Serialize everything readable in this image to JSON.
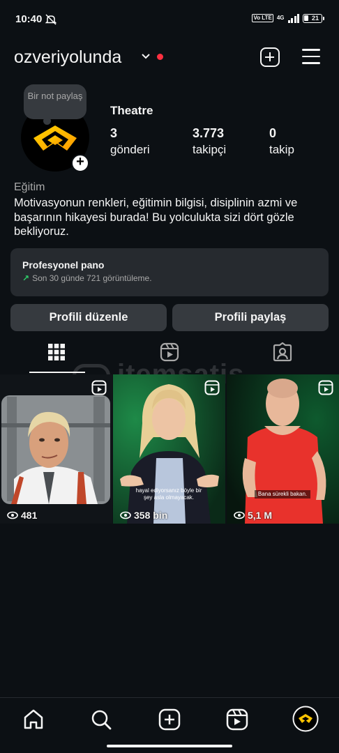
{
  "status_bar": {
    "time": "10:40",
    "volte": "Vo LTE",
    "network": "4G",
    "battery": "21"
  },
  "header": {
    "username": "ozveriyolunda"
  },
  "profile": {
    "note": "Bir not paylaş",
    "name": "Theatre",
    "stats": [
      {
        "value": "3",
        "label": "gönderi"
      },
      {
        "value": "3.773",
        "label": "takipçi"
      },
      {
        "value": "0",
        "label": "takip"
      }
    ],
    "category": "Eğitim",
    "bio": "Motivasyonun renkleri, eğitimin bilgisi, disiplinin azmi ve başarının hikayesi burada! Bu yolculukta sizi dört gözle bekliyoruz."
  },
  "pro_dashboard": {
    "title": "Profesyonel pano",
    "subtitle": "Son 30 günde 721 görüntüleme."
  },
  "buttons": {
    "edit_profile": "Profili düzenle",
    "share_profile": "Profili paylaş"
  },
  "watermark": "itemsatis",
  "posts": [
    {
      "views": "481",
      "caption": ""
    },
    {
      "views": "358 bin",
      "caption": "hayal ediyorsanız böyle bir şey asla olmayacak."
    },
    {
      "views": "5,1 M",
      "caption": "Bana sürekli bakan."
    }
  ],
  "colors": {
    "background": "#0c1014",
    "surface": "#262a2f",
    "button": "#363a3f",
    "notification_dot": "#ff3040",
    "trend_green": "#2fcf6a"
  },
  "icons": {
    "tabs": [
      "grid-icon",
      "reels-icon",
      "tagged-icon"
    ],
    "nav": [
      "home-icon",
      "search-icon",
      "create-icon",
      "reels-icon",
      "profile-avatar"
    ]
  }
}
